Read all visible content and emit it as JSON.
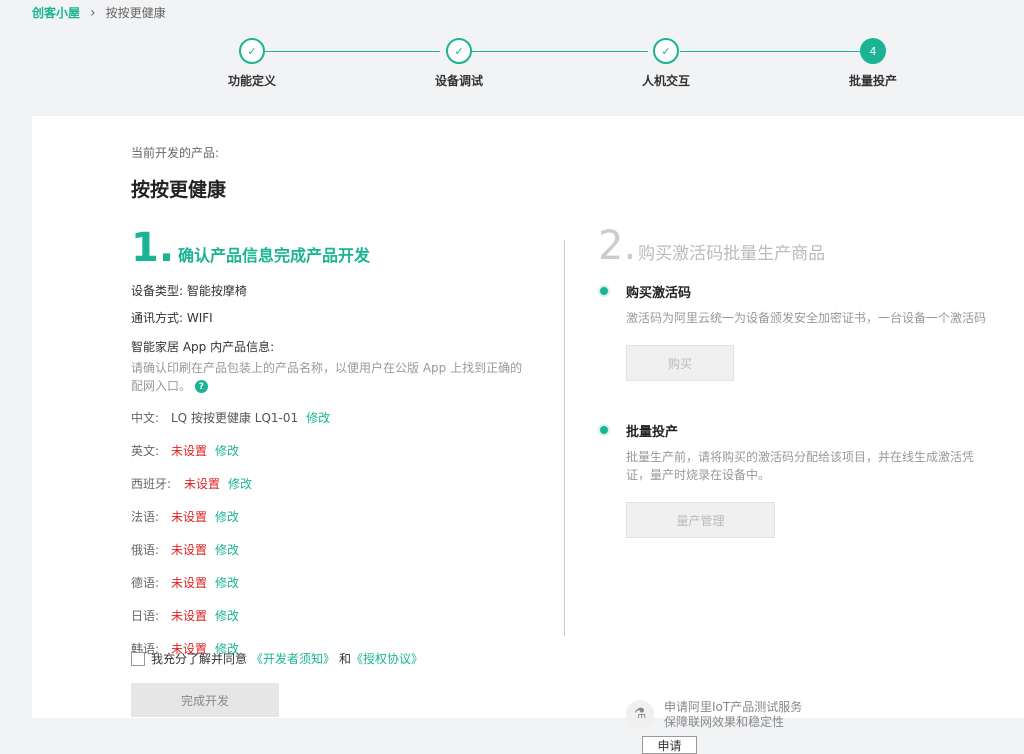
{
  "breadcrumb": {
    "home": "创客小屋",
    "current": "按按更健康"
  },
  "steps": [
    {
      "label": "功能定义",
      "status": "done"
    },
    {
      "label": "设备调试",
      "status": "done"
    },
    {
      "label": "人机交互",
      "status": "done"
    },
    {
      "label": "批量投产",
      "status": "active",
      "number": "4"
    }
  ],
  "product": {
    "intro": "当前开发的产品:",
    "name": "按按更健康"
  },
  "section1": {
    "number": "1.",
    "title": "确认产品信息完成产品开发",
    "device_type": "设备类型: 智能按摩椅",
    "comm": "通讯方式: WIFI",
    "app_info_label": "智能家居 App 内产品信息:",
    "hint": "请确认印刷在产品包装上的产品名称，以便用户在公版 App 上找到正确的配网入口。",
    "help_glyph": "?",
    "edit_label": "修改",
    "languages": [
      {
        "name": "中文:",
        "value": "LQ 按按更健康 LQ1-01",
        "unset": false
      },
      {
        "name": "英文:",
        "value": "未设置",
        "unset": true
      },
      {
        "name": "西班牙:",
        "value": "未设置",
        "unset": true
      },
      {
        "name": "法语:",
        "value": "未设置",
        "unset": true
      },
      {
        "name": "俄语:",
        "value": "未设置",
        "unset": true
      },
      {
        "name": "德语:",
        "value": "未设置",
        "unset": true
      },
      {
        "name": "日语:",
        "value": "未设置",
        "unset": true
      },
      {
        "name": "韩语:",
        "value": "未设置",
        "unset": true
      }
    ],
    "agree_text": "我充分了解并同意",
    "dev_notice": "《开发者须知》",
    "and": "和",
    "auth_agreement": "《授权协议》",
    "finish_button": "完成开发"
  },
  "section2": {
    "number": "2.",
    "title": "购买激活码批量生产商品",
    "buy": {
      "title": "购买激活码",
      "desc": "激活码为阿里云统一为设备颁发安全加密证书，一台设备一个激活码",
      "button": "购买"
    },
    "mass": {
      "title": "批量投产",
      "desc": "批量生产前，请将购买的激活码分配给该项目，并在线生成激活凭证，量产时烧录在设备中。",
      "button": "量产管理"
    },
    "iot": {
      "line1": "申请阿里IoT产品测试服务",
      "line2": "保障联网效果和稳定性",
      "button": "申请"
    }
  },
  "colors": {
    "accent": "#1ab394",
    "unset": "#e02020"
  }
}
